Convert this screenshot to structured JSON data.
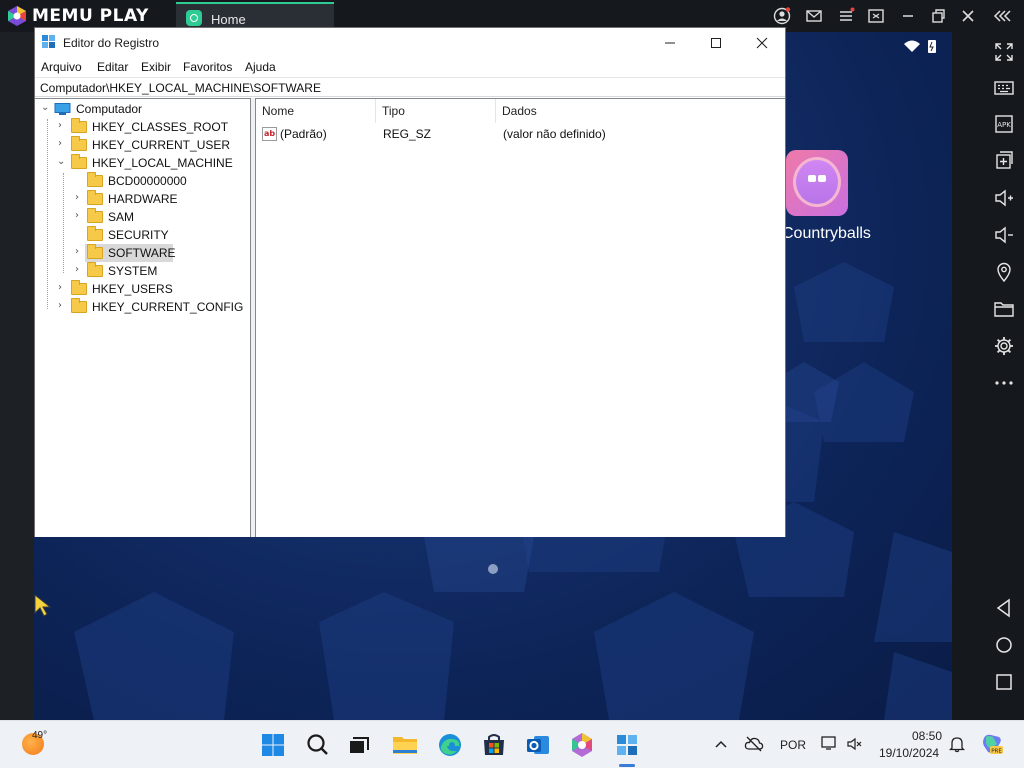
{
  "memu": {
    "brand": "MEMU PLAY",
    "tab_home": "Home",
    "titlebar_icons": [
      "account-icon",
      "mail-icon",
      "menu-icon",
      "screen-icon",
      "minimize-icon",
      "restore-icon",
      "close-icon",
      "collapse-sidebar-icon"
    ],
    "sidebar_icons": [
      "fullscreen-icon",
      "keyboard-icon",
      "apk-icon",
      "add-window-icon",
      "volume-up-icon",
      "volume-down-icon",
      "location-icon",
      "folder-icon",
      "settings-icon",
      "more-icon",
      "back-icon",
      "home-icon",
      "recents-icon"
    ]
  },
  "android": {
    "app_label": "Countryballs",
    "accent": "#c86fe0"
  },
  "regedit": {
    "title": "Editor do Registro",
    "menu": [
      "Arquivo",
      "Editar",
      "Exibir",
      "Favoritos",
      "Ajuda"
    ],
    "address": "Computador\\HKEY_LOCAL_MACHINE\\SOFTWARE",
    "tree": {
      "root": "Computador",
      "hives": [
        "HKEY_CLASSES_ROOT",
        "HKEY_CURRENT_USER",
        "HKEY_LOCAL_MACHINE",
        "HKEY_USERS",
        "HKEY_CURRENT_CONFIG"
      ],
      "hklm_children": [
        "BCD00000000",
        "HARDWARE",
        "SAM",
        "SECURITY",
        "SOFTWARE",
        "SYSTEM"
      ],
      "selected": "SOFTWARE"
    },
    "columns": [
      "Nome",
      "Tipo",
      "Dados"
    ],
    "values": [
      {
        "name": "(Padrão)",
        "type": "REG_SZ",
        "data": "(valor não definido)"
      }
    ]
  },
  "taskbar": {
    "weather_temp": "49°",
    "pinned_apps": [
      "start-icon",
      "search-icon",
      "task-view-icon",
      "file-explorer-icon",
      "edge-icon",
      "store-icon",
      "outlook-icon",
      "copilot-icon",
      "regedit-icon"
    ],
    "language": "POR",
    "time": "08:50",
    "date": "19/10/2024"
  }
}
